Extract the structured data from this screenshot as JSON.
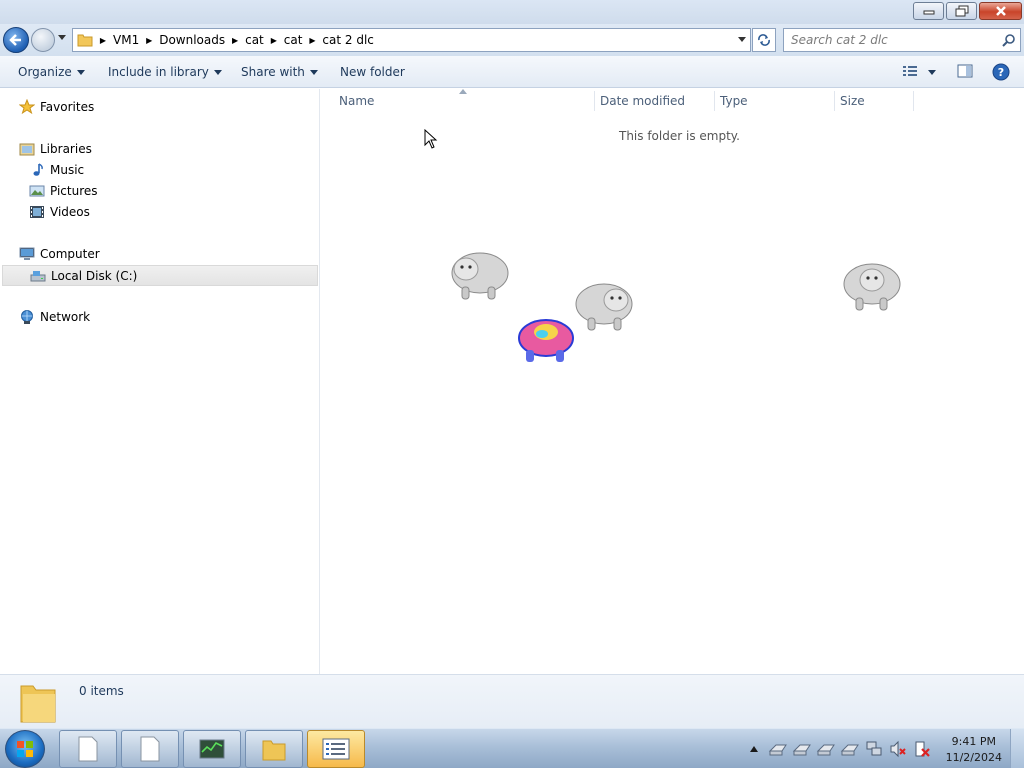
{
  "window": {
    "buttons": [
      "minimize",
      "restore",
      "close"
    ]
  },
  "navbar": {
    "breadcrumb": [
      "VM1",
      "Downloads",
      "cat",
      "cat",
      "cat 2 dlc"
    ],
    "search_placeholder": "Search cat 2 dlc"
  },
  "toolbar": {
    "organize": "Organize",
    "include_in_library": "Include in library",
    "share_with": "Share with",
    "new_folder": "New folder"
  },
  "sidebar": {
    "favorites": "Favorites",
    "libraries": "Libraries",
    "music": "Music",
    "pictures": "Pictures",
    "videos": "Videos",
    "computer": "Computer",
    "local_disk": "Local Disk (C:)",
    "network": "Network"
  },
  "content": {
    "columns": [
      "Name",
      "Date modified",
      "Type",
      "Size"
    ],
    "empty_message": "This folder is empty."
  },
  "details": {
    "item_count": "0 items"
  },
  "taskbar": {
    "time": "9:41 PM",
    "date": "11/2/2024"
  },
  "colors": {
    "accent": "#1e395b",
    "selected_bg": "#e8e8e8",
    "active_task": "#f6b94a"
  }
}
